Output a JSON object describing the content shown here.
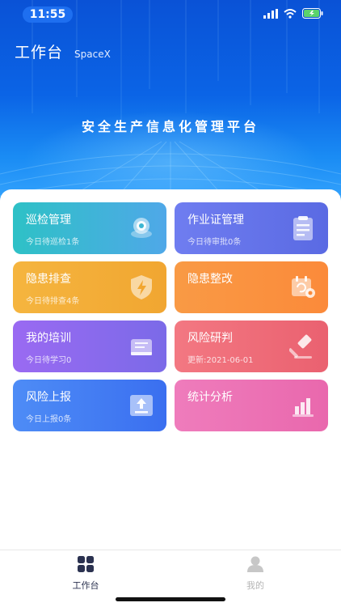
{
  "status_bar": {
    "time": "11:55"
  },
  "header": {
    "title": "工作台",
    "subtitle": "SpaceX"
  },
  "slogan": "安全生产信息化管理平台",
  "cards": [
    {
      "title": "巡检管理",
      "subtitle": "今日待巡检1条",
      "icon": "camera-icon"
    },
    {
      "title": "作业证管理",
      "subtitle": "今日待审批0条",
      "icon": "clipboard-icon"
    },
    {
      "title": "隐患排查",
      "subtitle": "今日待排查4条",
      "icon": "shield-lightning-icon"
    },
    {
      "title": "隐患整改",
      "subtitle": "",
      "icon": "calendar-refresh-icon"
    },
    {
      "title": "我的培训",
      "subtitle": "今日待学习0",
      "icon": "book-icon"
    },
    {
      "title": "风险研判",
      "subtitle": "更新:2021-06-01",
      "icon": "gavel-icon"
    },
    {
      "title": "风险上报",
      "subtitle": "今日上报0条",
      "icon": "upload-icon"
    },
    {
      "title": "统计分析",
      "subtitle": "",
      "icon": "bar-chart-icon"
    }
  ],
  "tabbar": {
    "items": [
      {
        "label": "工作台",
        "icon": "grid-icon",
        "active": true
      },
      {
        "label": "我的",
        "icon": "user-icon",
        "active": false
      }
    ]
  },
  "colors": {
    "hero_blue": "#0b64e6",
    "active_tab": "#2b3250",
    "inactive_tab": "#b5b5b5"
  }
}
